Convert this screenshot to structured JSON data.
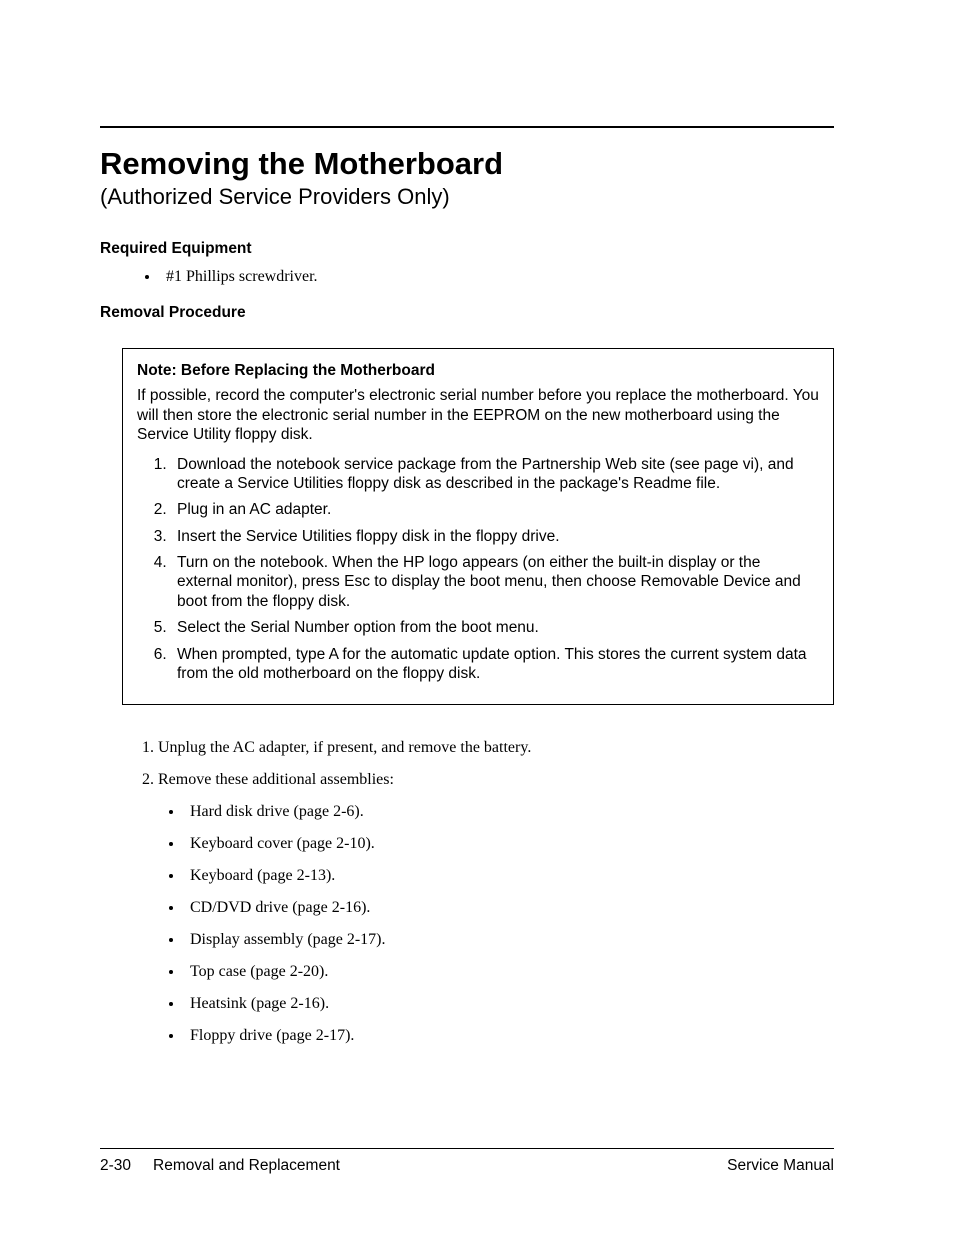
{
  "header": {
    "title": "Removing the Motherboard",
    "subtitle": "(Authorized Service Providers Only)"
  },
  "equipment": {
    "label": "Required Equipment",
    "items": [
      "#1 Phillips screwdriver."
    ]
  },
  "procedure": {
    "label": "Removal Procedure"
  },
  "note": {
    "title": "Note: Before Replacing the Motherboard",
    "intro": "If possible, record the computer's electronic serial number before you replace the motherboard. You will then store the electronic serial number in the EEPROM on the new motherboard using the Service Utility floppy disk.",
    "steps": [
      "Download the notebook service package from the Partnership Web site (see page vi), and create a Service Utilities floppy disk as described in the package's Readme file.",
      "Plug in an AC adapter.",
      "Insert the Service Utilities floppy disk in the floppy drive.",
      "Turn on the notebook. When the HP logo appears (on either the built-in display or the external monitor), press Esc to display the boot menu, then choose Removable Device and boot from the floppy disk.",
      "Select the Serial Number option from the boot menu.",
      "When prompted, type A for the automatic update option. This stores the current system data from the old motherboard on the floppy disk."
    ]
  },
  "main_steps": {
    "s1": "Unplug the AC adapter, if present, and remove the battery.",
    "s2": "Remove these additional assemblies:",
    "assemblies": [
      "Hard disk drive (page 2-6).",
      "Keyboard cover (page 2-10).",
      "Keyboard (page 2-13).",
      "CD/DVD drive (page 2-16).",
      "Display assembly (page 2-17).",
      "Top case (page 2-20).",
      "Heatsink (page 2-16).",
      "Floppy drive (page 2-17)."
    ]
  },
  "footer": {
    "page_num": "2-30",
    "section": "Removal and Replacement",
    "doc": "Service Manual"
  }
}
